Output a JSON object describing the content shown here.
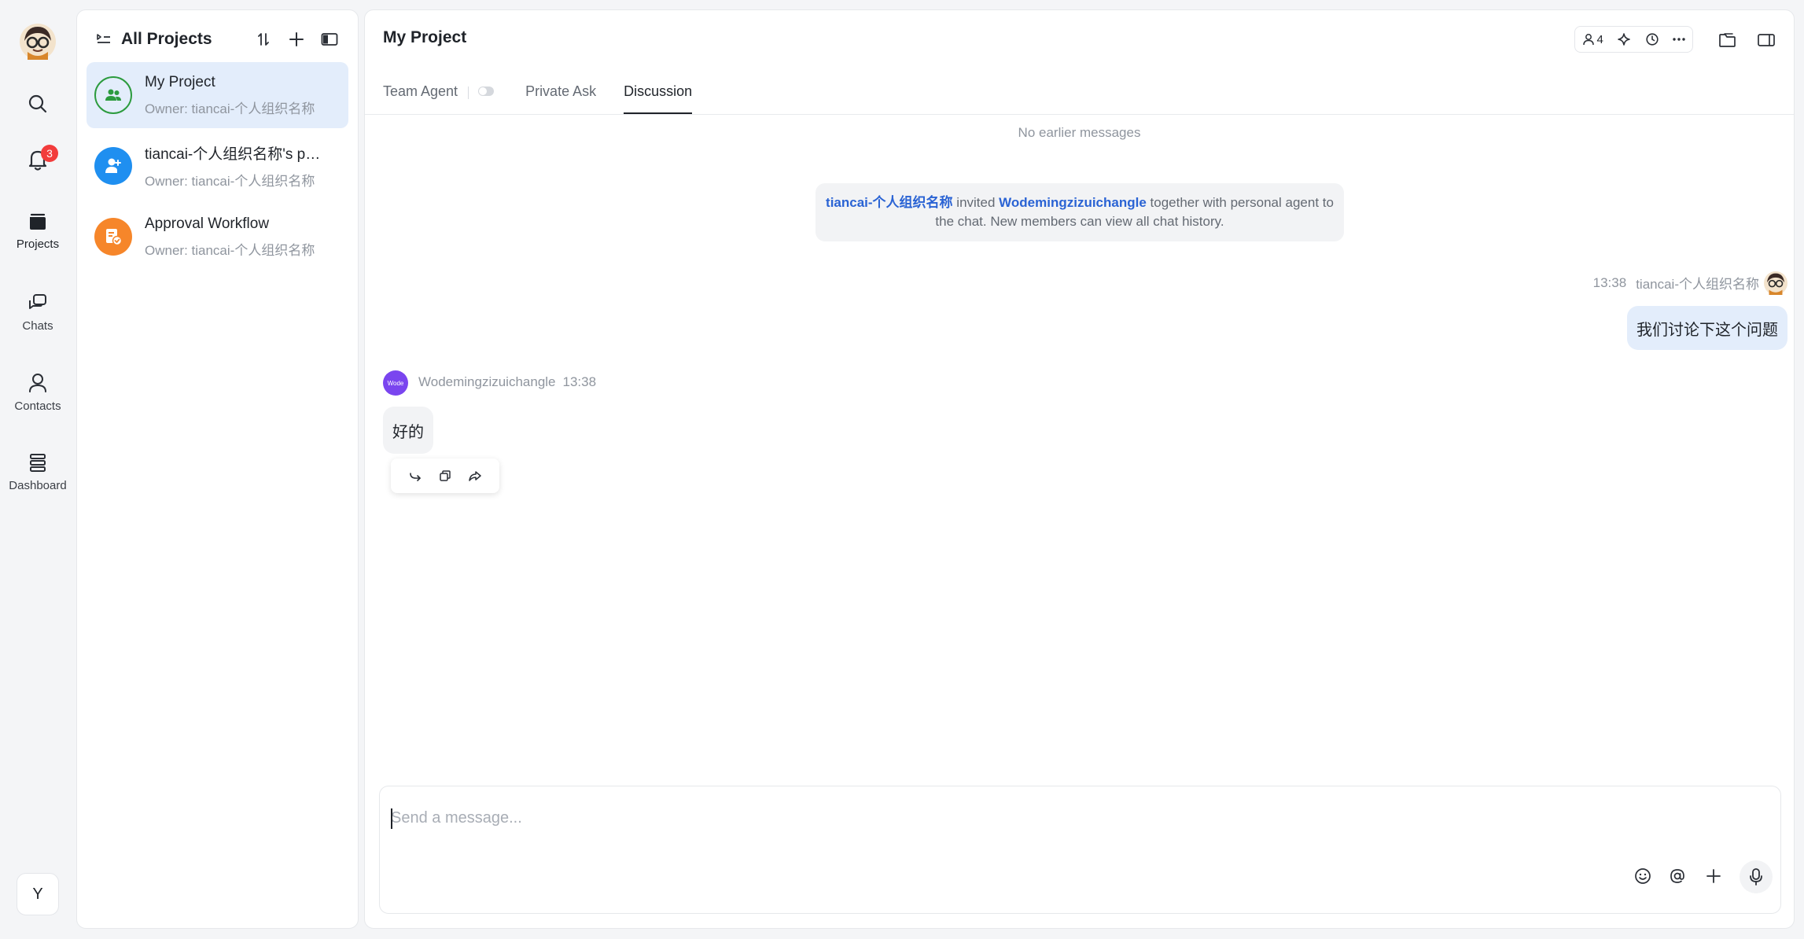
{
  "rail": {
    "nav": [
      {
        "label": "Projects",
        "icon": "folder-icon"
      },
      {
        "label": "Chats",
        "icon": "chat-bubbles-icon"
      },
      {
        "label": "Contacts",
        "icon": "person-icon"
      },
      {
        "label": "Dashboard",
        "icon": "stack-icon"
      }
    ],
    "notification_count": "3",
    "user_initial": "Y"
  },
  "project_list": {
    "title": "All Projects",
    "items": [
      {
        "name": "My Project",
        "owner": "Owner: tiancai-个人组织名称",
        "icon_color": "#2c9b3e"
      },
      {
        "name": "tiancai-个人组织名称's p…",
        "owner": "Owner: tiancai-个人组织名称",
        "icon_color": "#1f8ff0"
      },
      {
        "name": "Approval Workflow",
        "owner": "Owner: tiancai-个人组织名称",
        "icon_color": "#f6862a"
      }
    ]
  },
  "main": {
    "title": "My Project",
    "member_count": "4",
    "tabs": [
      "Team Agent",
      "Private Ask",
      "Discussion"
    ],
    "active_tab": "Discussion",
    "no_earlier": "No earlier messages",
    "system_message": {
      "inviter": "tiancai-个人组织名称",
      "text1": " invited ",
      "invitee": "Wodemingzizuichangle",
      "text2": " together with personal agent to the chat. New members can view all chat history."
    },
    "outgoing": {
      "time": "13:38",
      "sender": "tiancai-个人组织名称",
      "text": "我们讨论下这个问题"
    },
    "incoming": {
      "avatar_text": "Wode",
      "sender": "Wodemingzizuichangle",
      "time": "13:38",
      "text": "好的"
    },
    "composer": {
      "placeholder": "Send a message...",
      "value": ""
    }
  },
  "colors": {
    "accent": "#2a63d4",
    "selected_bg": "#e3edfb",
    "badge": "#f23c3c"
  }
}
